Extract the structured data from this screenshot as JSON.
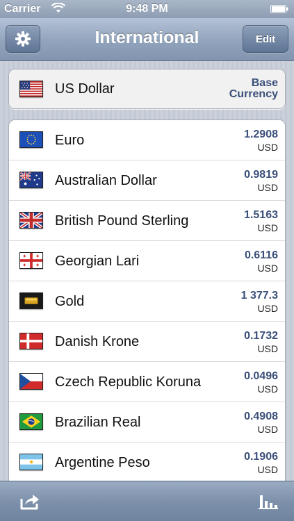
{
  "status_bar": {
    "carrier": "Carrier",
    "time": "9:48 PM"
  },
  "nav": {
    "title": "International",
    "edit_label": "Edit"
  },
  "base": {
    "name": "US Dollar",
    "label_line1": "Base",
    "label_line2": "Currency",
    "flag": "us-flag"
  },
  "currencies": [
    {
      "name": "Euro",
      "rate": "1.2908",
      "unit": "USD",
      "flag": "eu-flag"
    },
    {
      "name": "Australian Dollar",
      "rate": "0.9819",
      "unit": "USD",
      "flag": "au-flag"
    },
    {
      "name": "British Pound Sterling",
      "rate": "1.5163",
      "unit": "USD",
      "flag": "gb-flag"
    },
    {
      "name": "Georgian Lari",
      "rate": "0.6116",
      "unit": "USD",
      "flag": "ge-flag"
    },
    {
      "name": "Gold",
      "rate": "1 377.3",
      "unit": "USD",
      "flag": "gold-bar-icon"
    },
    {
      "name": "Danish Krone",
      "rate": "0.1732",
      "unit": "USD",
      "flag": "dk-flag"
    },
    {
      "name": "Czech Republic Koruna",
      "rate": "0.0496",
      "unit": "USD",
      "flag": "cz-flag"
    },
    {
      "name": "Brazilian Real",
      "rate": "0.4908",
      "unit": "USD",
      "flag": "br-flag"
    },
    {
      "name": "Argentine Peso",
      "rate": "0.1906",
      "unit": "USD",
      "flag": "ar-flag"
    }
  ],
  "toolbar": {
    "left_icon": "share-icon",
    "right_icon": "chart-icon"
  },
  "colors": {
    "accent": "#3b4f7a",
    "nav_bar": "#8294ae"
  }
}
